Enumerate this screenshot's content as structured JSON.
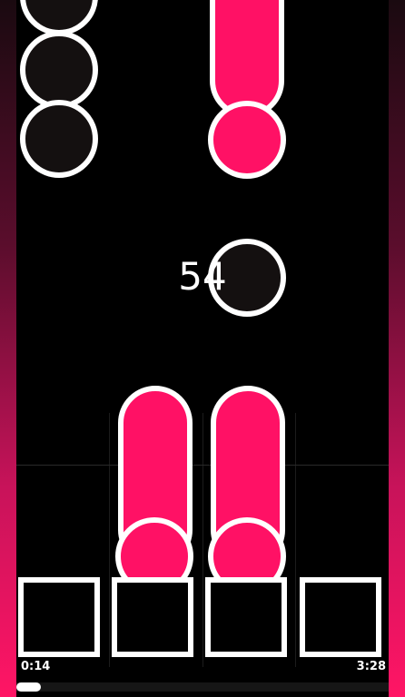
{
  "game": {
    "combo": "54",
    "time_elapsed": "0:14",
    "time_total": "3:28",
    "progress_fraction": 0.067
  },
  "colors": {
    "note_pink": "#ff1165",
    "note_dark": "#141010",
    "outline": "#ffffff",
    "background": "#000000"
  }
}
